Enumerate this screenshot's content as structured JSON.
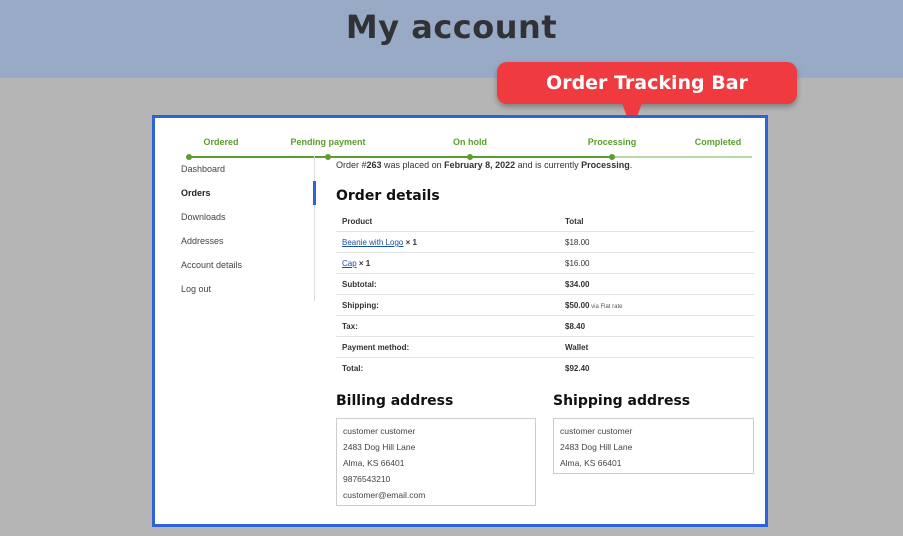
{
  "page": {
    "title": "My account"
  },
  "annotation": {
    "callout_label": "Order Tracking Bar"
  },
  "tracker": {
    "steps": [
      "Ordered",
      "Pending payment",
      "On hold",
      "Processing",
      "Completed"
    ],
    "current_step": "Processing",
    "progress_fraction": 0.75
  },
  "nav": {
    "items": [
      "Dashboard",
      "Orders",
      "Downloads",
      "Addresses",
      "Account details",
      "Log out"
    ],
    "active": "Orders"
  },
  "order": {
    "status_prefix": "Order #",
    "number": "263",
    "placed_text": " was placed on ",
    "date": "February 8, 2022",
    "status_mid": " and is currently ",
    "status": "Processing",
    "status_suffix": "."
  },
  "order_details": {
    "heading": "Order details",
    "col_product": "Product",
    "col_total": "Total",
    "items": [
      {
        "name": "Beanie with Logo",
        "qty": " × 1",
        "total": "$18.00"
      },
      {
        "name": "Cap",
        "qty": " × 1",
        "total": "$16.00"
      }
    ],
    "subtotal_label": "Subtotal:",
    "subtotal": "$34.00",
    "shipping_label": "Shipping:",
    "shipping": "$50.00",
    "shipping_via": " via Flat rate",
    "tax_label": "Tax:",
    "tax": "$8.40",
    "payment_label": "Payment method:",
    "payment": "Wallet",
    "total_label": "Total:",
    "total": "$92.40"
  },
  "billing": {
    "heading": "Billing address",
    "lines": [
      "customer customer",
      "2483 Dog Hill Lane",
      "Alma, KS 66401",
      "9876543210",
      "customer@email.com"
    ]
  },
  "shipping_addr": {
    "heading": "Shipping address",
    "lines": [
      "customer customer",
      "2483 Dog Hill Lane",
      "Alma, KS 66401"
    ]
  },
  "colors": {
    "accent": "#2f62d6",
    "tracker": "#5b9e2f",
    "callout": "#ef3b3f"
  }
}
